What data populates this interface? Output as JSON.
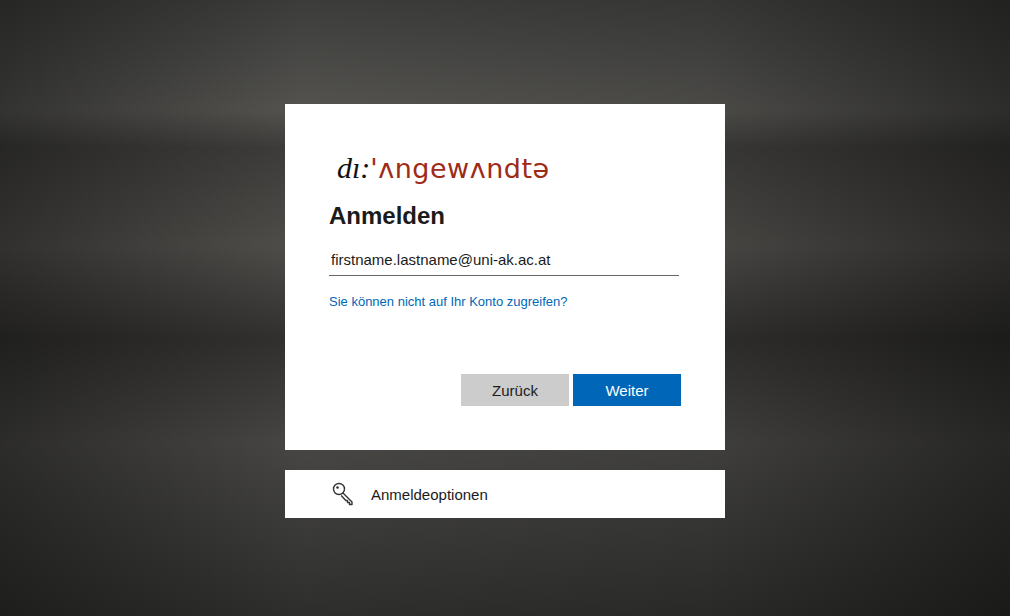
{
  "logo": {
    "prefix": "dı:",
    "name": "'ʌngewʌndtə"
  },
  "title": "Anmelden",
  "email": {
    "value": "firstname.lastname@uni-ak.ac.at"
  },
  "help_link": "Sie können nicht auf Ihr Konto zugreifen?",
  "buttons": [
    {
      "label": "Zurück",
      "kind": "secondary"
    },
    {
      "label": "Weiter",
      "kind": "primary"
    }
  ],
  "sign_in_options": "Anmeldeoptionen"
}
